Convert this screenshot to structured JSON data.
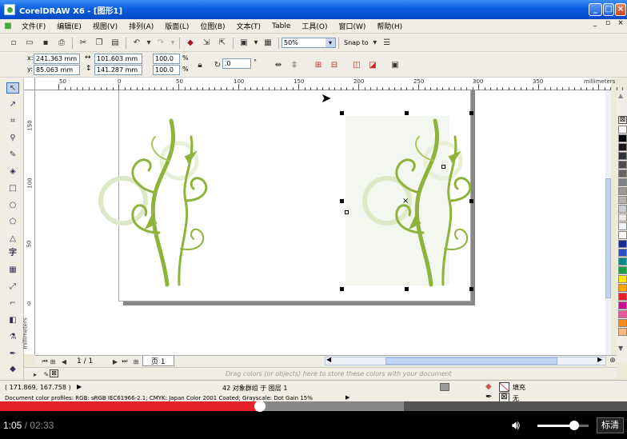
{
  "window": {
    "title": "CorelDRAW X6 - [图形1]"
  },
  "menu": [
    "文件(F)",
    "编辑(E)",
    "视图(V)",
    "排列(A)",
    "版面(L)",
    "位图(B)",
    "文本(T)",
    "Table",
    "工具(O)",
    "窗口(W)",
    "帮助(H)"
  ],
  "menu_right": [
    "_",
    "▫",
    "×"
  ],
  "toolbar": {
    "zoom_value": "50%",
    "snap_to_label": "Snap to"
  },
  "property_bar": {
    "x_label": "x:",
    "x_value": "241.363 mm",
    "y_label": "y:",
    "y_value": "85.063 mm",
    "width_value": "101.603 mm",
    "height_value": "141.287 mm",
    "scale_x": "100.0",
    "scale_y": "100.0",
    "pct": "%",
    "rotation_value": ".0",
    "degree_symbol": "°"
  },
  "ruler": {
    "units_label": "millimeters",
    "h_ticks": [
      "50",
      "0",
      "50",
      "100",
      "150",
      "200",
      "250",
      "300",
      "350"
    ],
    "v_ticks": [
      "150",
      "100",
      "50",
      "0"
    ]
  },
  "page_nav": {
    "current": "1 / 1",
    "page_tab": "页 1"
  },
  "color_dock": {
    "hint": "Drag colors (or objects) here to store these colors with your document"
  },
  "status": {
    "cursor_coords": "( 171.869, 167.758 )",
    "selection_info": "42 对象群组 于 图层 1",
    "color_profiles": "Document color profiles: RGB: sRGB IEC61966-2.1; CMYK: Japan Color 2001 Coated; Grayscale: Dot Gain 15%",
    "fill_label": "填充",
    "outline_label": "无"
  },
  "video": {
    "current_time": "1:05",
    "separator": " / ",
    "total_time": "02:33",
    "quality_label": "标清",
    "progress": 0.415
  },
  "palette_colors": [
    "#ffffff",
    "#000000",
    "#1a1a1a",
    "#333333",
    "#4d4d4d",
    "#666666",
    "#808080",
    "#999999",
    "#b3b3b3",
    "#cccccc",
    "#e6e6e6",
    "#f2f2f2",
    "#ffffff",
    "#1e2a8c",
    "#2a4fbf",
    "#0a8a8a",
    "#1e9e4a",
    "#ffe600",
    "#f7a600",
    "#e6212a",
    "#c8148c",
    "#e85a9a",
    "#f28c1e",
    "#f7b980"
  ],
  "artwork": {
    "vine_color": "#8db33a",
    "vine_light": "#c8dc96"
  }
}
